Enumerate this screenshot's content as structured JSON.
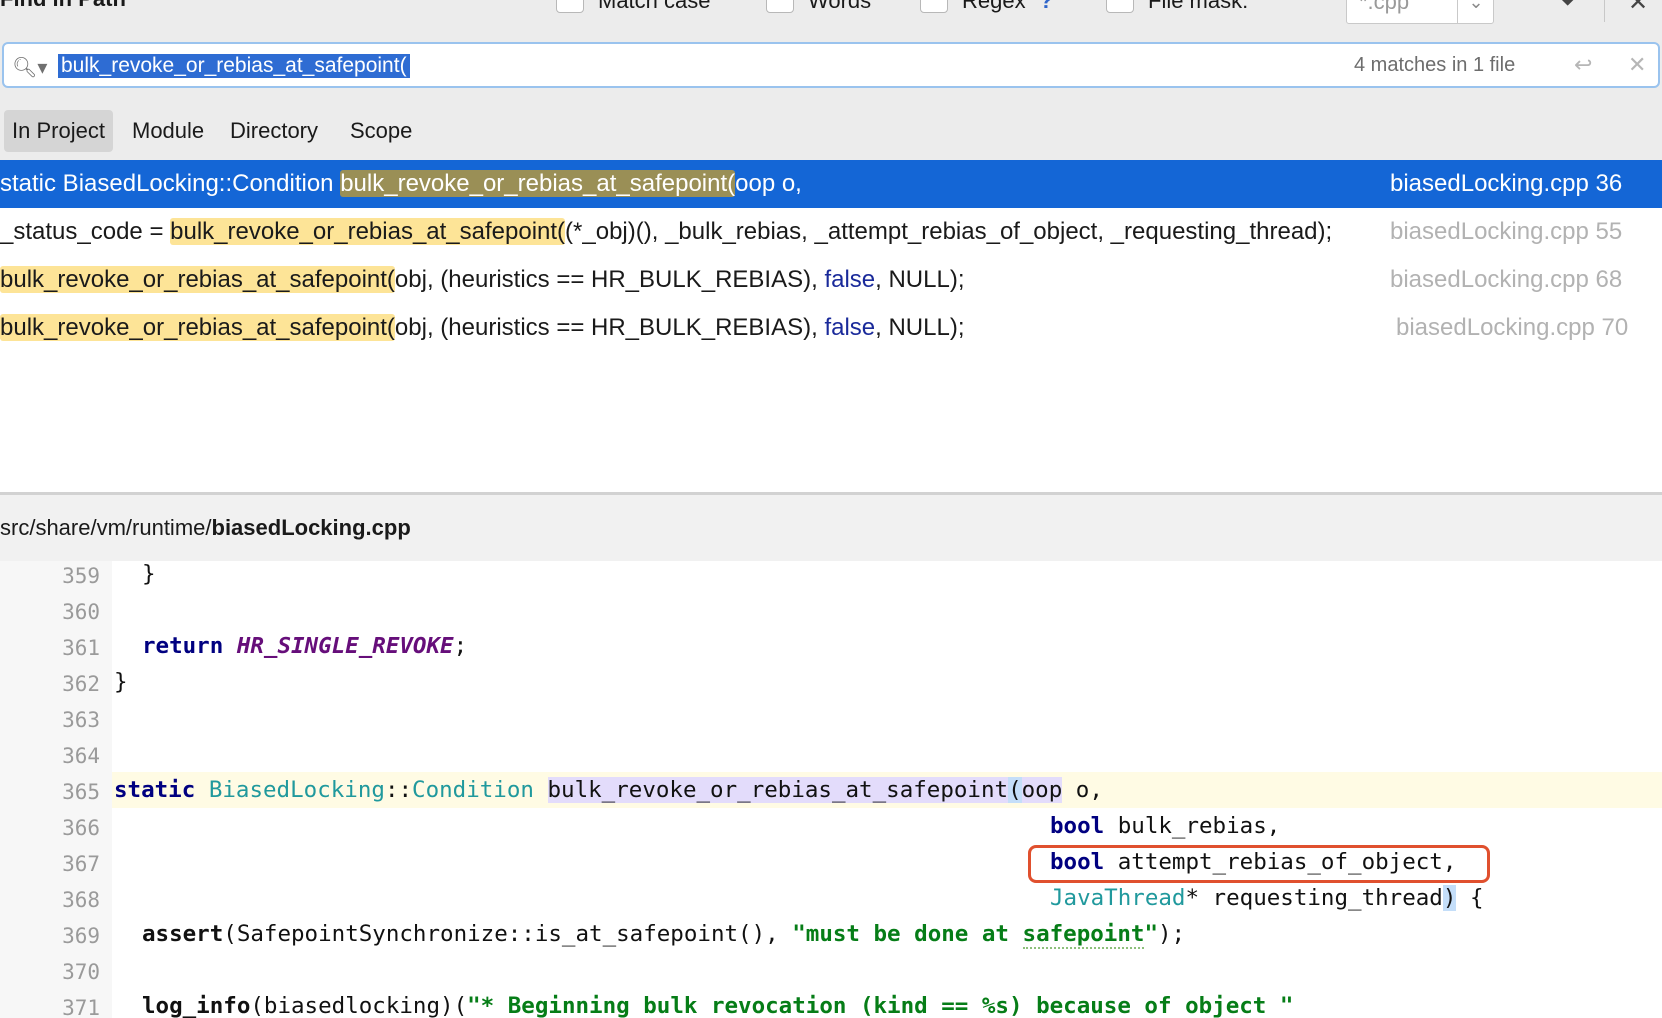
{
  "window": {
    "title": "Find in Path"
  },
  "options": {
    "match_case": "Match case",
    "words": "Words",
    "regex": "Regex",
    "regex_help": "?",
    "file_mask_label": "File mask:",
    "file_mask_value": "*.cpp"
  },
  "search": {
    "query": "bulk_revoke_or_rebias_at_safepoint(",
    "match_count": "4 matches in 1 file"
  },
  "scopes": [
    {
      "label": "In Project",
      "active": true
    },
    {
      "label": "Module"
    },
    {
      "label": "Directory"
    },
    {
      "label": "Scope"
    }
  ],
  "results": [
    {
      "pre": "static BiasedLocking::Condition ",
      "match": "bulk_revoke_or_rebias_at_safepoint(",
      "post": "oop o,",
      "post_kw": "",
      "post_tail": "",
      "file": "biasedLocking.cpp 36",
      "selected": true
    },
    {
      "pre": "_status_code = ",
      "match": "bulk_revoke_or_rebias_at_safepoint(",
      "post": "(*_obj)(), _bulk_rebias, _attempt_rebias_of_object, _requesting_thread);",
      "post_kw": "",
      "post_tail": "",
      "file": "biasedLocking.cpp 55"
    },
    {
      "pre": "",
      "match": "bulk_revoke_or_rebias_at_safepoint(",
      "post": "obj, (heuristics == HR_BULK_REBIAS), ",
      "post_kw": "false",
      "post_tail": ", NULL);",
      "file": "biasedLocking.cpp 68"
    },
    {
      "pre": "",
      "match": "bulk_revoke_or_rebias_at_safepoint(",
      "post": "obj, (heuristics == HR_BULK_REBIAS), ",
      "post_kw": "false",
      "post_tail": ", NULL);",
      "file": "biasedLocking.cpp 70"
    }
  ],
  "preview": {
    "path_dir": "src/share/vm/runtime/",
    "path_file": "biasedLocking.cpp",
    "line_numbers": [
      "359",
      "360",
      "361",
      "362",
      "363",
      "364",
      "365",
      "366",
      "367",
      "368",
      "369",
      "370",
      "371"
    ],
    "code": {
      "l359": "}",
      "l361_kw": "return",
      "l361_const": "HR_SINGLE_REVOKE",
      "l361_end": ";",
      "l362": "}",
      "l365_kw": "static",
      "l365_cls1": "BiasedLocking",
      "l365_sep": "::",
      "l365_cls2": "Condition",
      "l365_fn": "bulk_revoke_or_rebias_at_safepoint",
      "l365_paren": "(",
      "l365_type": "oop",
      "l365_rest": " o,",
      "l366_kw": "bool",
      "l366_rest": " bulk_rebias,",
      "l367_kw": "bool",
      "l367_rest": " attempt_rebias_of_object,",
      "l368_cls": "JavaThread",
      "l368_rest": "* requesting_thread",
      "l368_paren": ")",
      "l368_end": " {",
      "l369_fn": "assert",
      "l369_mid": "(SafepointSynchronize::is_at_safepoint(), ",
      "l369_str1": "\"must be done at ",
      "l369_str2": "safepoint",
      "l369_str3": "\"",
      "l369_end": ");",
      "l371_fn1": "log_info",
      "l371_mid": "(biasedlocking)(",
      "l371_str": "\"* Beginning bulk revocation (kind == %s) because of object \""
    }
  },
  "colors": {
    "selection": "#1466d6",
    "match_highlight": "#fde497",
    "annotation_box": "#e0502e"
  }
}
